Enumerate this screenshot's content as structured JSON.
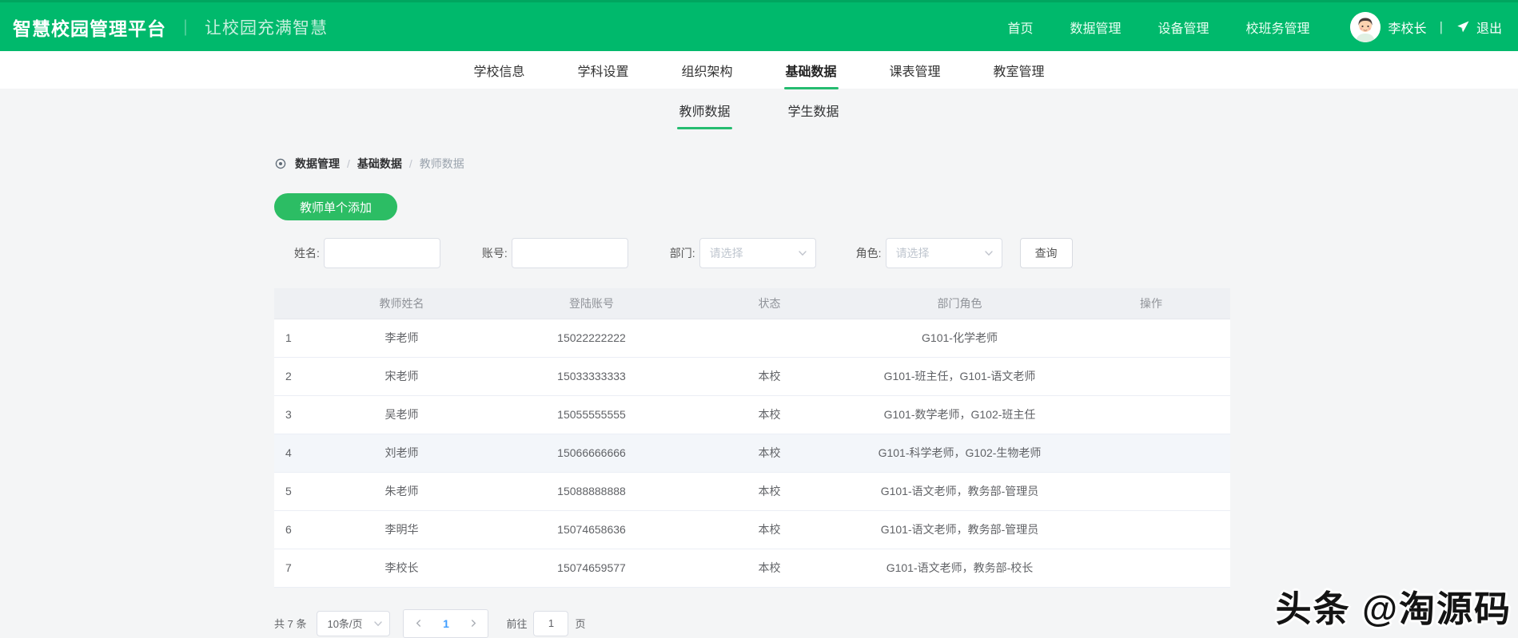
{
  "colors": {
    "brand_green": "#00b96c",
    "accent_green": "#25bc70",
    "button_green": "#2cbd64",
    "link_blue": "#409eff"
  },
  "header": {
    "title": "智慧校园管理平台",
    "separator": "｜",
    "subtitle": "让校园充满智慧",
    "nav": [
      {
        "label": "首页"
      },
      {
        "label": "数据管理"
      },
      {
        "label": "设备管理"
      },
      {
        "label": "校班务管理"
      }
    ],
    "user": {
      "name": "李校长",
      "avatar_icon": "user-avatar",
      "divider": "|",
      "logout_icon": "paper-plane-icon",
      "logout_label": "退出"
    }
  },
  "subnav": {
    "items": [
      "学校信息",
      "学科设置",
      "组织架构",
      "基础数据",
      "课表管理",
      "教室管理"
    ],
    "active": "基础数据"
  },
  "tabs": {
    "items": [
      "教师数据",
      "学生数据"
    ],
    "active": "教师数据"
  },
  "breadcrumb": {
    "icon": "location-icon",
    "items": [
      "数据管理",
      "基础数据",
      "教师数据"
    ],
    "separator": "/"
  },
  "toolbar": {
    "add_button": "教师单个添加"
  },
  "filters": {
    "name_label": "姓名:",
    "account_label": "账号:",
    "department_label": "部门:",
    "role_label": "角色:",
    "select_placeholder": "请选择",
    "search_button": "查询"
  },
  "table": {
    "columns": [
      "教师姓名",
      "登陆账号",
      "状态",
      "部门角色",
      "操作"
    ],
    "highlighted_row": 4,
    "rows": [
      {
        "index": "1",
        "name": "李老师",
        "account": "15022222222",
        "status": "",
        "roles": "G101-化学老师",
        "ops": ""
      },
      {
        "index": "2",
        "name": "宋老师",
        "account": "15033333333",
        "status": "本校",
        "roles": "G101-班主任，G101-语文老师",
        "ops": ""
      },
      {
        "index": "3",
        "name": "吴老师",
        "account": "15055555555",
        "status": "本校",
        "roles": "G101-数学老师，G102-班主任",
        "ops": ""
      },
      {
        "index": "4",
        "name": "刘老师",
        "account": "15066666666",
        "status": "本校",
        "roles": "G101-科学老师，G102-生物老师",
        "ops": ""
      },
      {
        "index": "5",
        "name": "朱老师",
        "account": "15088888888",
        "status": "本校",
        "roles": "G101-语文老师，教务部-管理员",
        "ops": ""
      },
      {
        "index": "6",
        "name": "李明华",
        "account": "15074658636",
        "status": "本校",
        "roles": "G101-语文老师，教务部-管理员",
        "ops": ""
      },
      {
        "index": "7",
        "name": "李校长",
        "account": "15074659577",
        "status": "本校",
        "roles": "G101-语文老师，教务部-校长",
        "ops": ""
      }
    ]
  },
  "pagination": {
    "total": "共 7 条",
    "page_size": "10条/页",
    "current_page": "1",
    "goto_label": "前往",
    "goto_value": "1",
    "page_label": "页"
  },
  "watermark": "头条 @淘源码"
}
